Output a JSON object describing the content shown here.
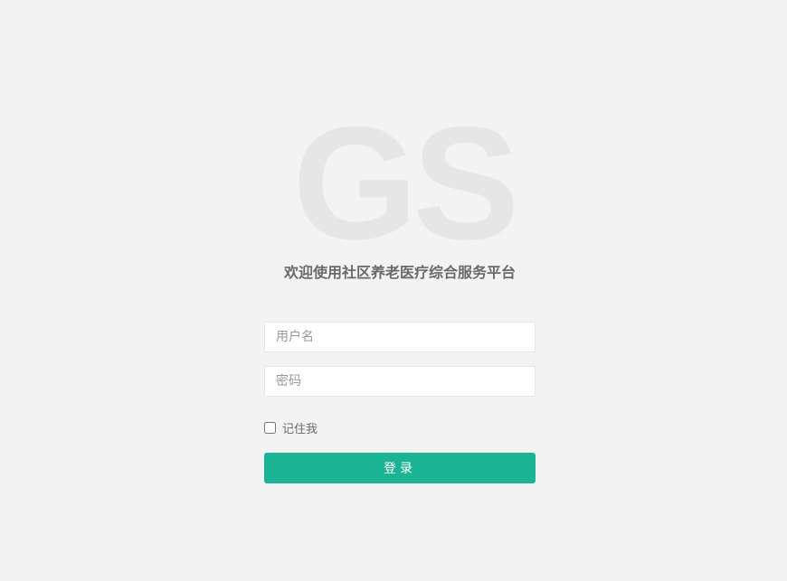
{
  "logo": {
    "text": "GS"
  },
  "title": "欢迎使用社区养老医疗综合服务平台",
  "form": {
    "username": {
      "placeholder": "用户名",
      "value": ""
    },
    "password": {
      "placeholder": "密码",
      "value": ""
    },
    "remember_label": "记住我",
    "remember_checked": false,
    "submit_label": "登录"
  },
  "colors": {
    "background": "#f3f3f4",
    "logo": "#e6e6e6",
    "accent": "#1ab394",
    "text": "#676a6c"
  }
}
